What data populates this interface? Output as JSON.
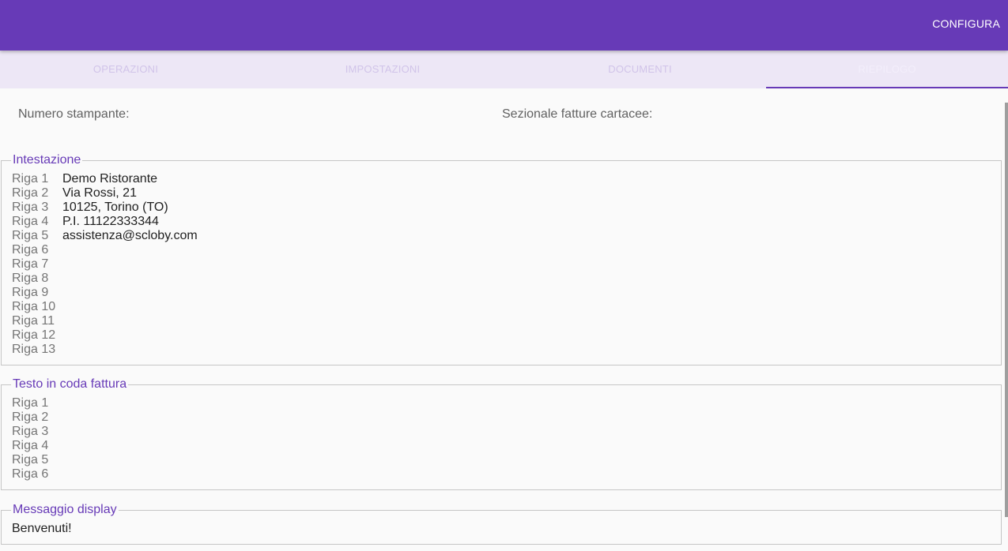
{
  "app_bar": {
    "configura_label": "CONFIGURA"
  },
  "tabs": [
    {
      "label": "OPERAZIONI",
      "active": false
    },
    {
      "label": "IMPOSTAZIONI",
      "active": false
    },
    {
      "label": "DOCUMENTI",
      "active": false
    },
    {
      "label": "RIEPILOGO",
      "active": true
    }
  ],
  "summary": {
    "printer_number_label": "Numero stampante:",
    "sezionale_label": "Sezionale fatture cartacee:"
  },
  "intestazione": {
    "title": "Intestazione",
    "rows": [
      {
        "label": "Riga 1",
        "value": "Demo Ristorante"
      },
      {
        "label": "Riga 2",
        "value": "Via Rossi, 21"
      },
      {
        "label": "Riga 3",
        "value": "10125, Torino (TO)"
      },
      {
        "label": "Riga 4",
        "value": "P.I. 11122333344"
      },
      {
        "label": "Riga 5",
        "value": "assistenza@scloby.com"
      },
      {
        "label": "Riga 6",
        "value": ""
      },
      {
        "label": "Riga 7",
        "value": ""
      },
      {
        "label": "Riga 8",
        "value": ""
      },
      {
        "label": "Riga 9",
        "value": ""
      },
      {
        "label": "Riga 10",
        "value": ""
      },
      {
        "label": "Riga 11",
        "value": ""
      },
      {
        "label": "Riga 12",
        "value": ""
      },
      {
        "label": "Riga 13",
        "value": ""
      }
    ]
  },
  "testo_coda": {
    "title": "Testo in coda fattura",
    "rows": [
      {
        "label": "Riga 1",
        "value": ""
      },
      {
        "label": "Riga 2",
        "value": ""
      },
      {
        "label": "Riga 3",
        "value": ""
      },
      {
        "label": "Riga 4",
        "value": ""
      },
      {
        "label": "Riga 5",
        "value": ""
      },
      {
        "label": "Riga 6",
        "value": ""
      }
    ]
  },
  "messaggio_display": {
    "title": "Messaggio display",
    "text": "Benvenuti!"
  },
  "colors": {
    "primary": "#673ab7",
    "tab_bar_bg": "#ede7f6"
  }
}
